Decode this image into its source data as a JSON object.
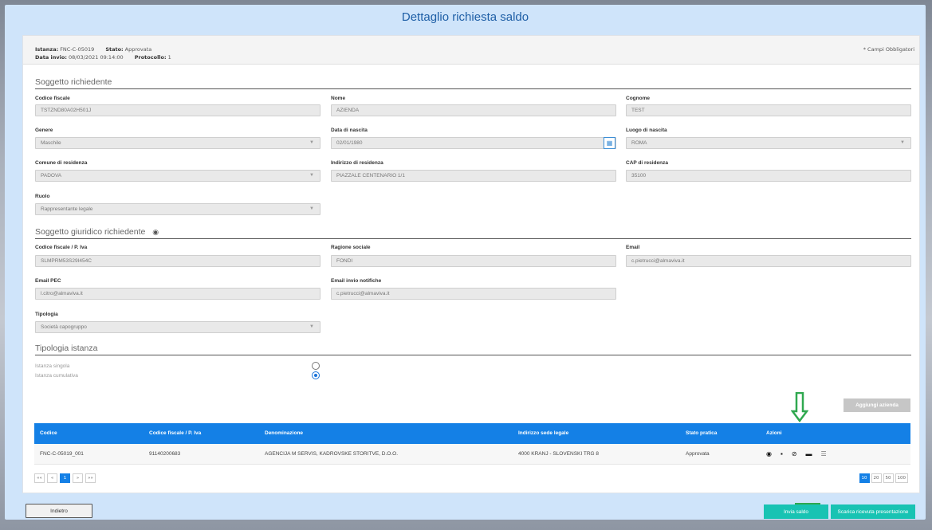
{
  "page": {
    "title": "Dettaglio richiesta saldo"
  },
  "info": {
    "istanza_label": "Istanza:",
    "istanza_value": "FNC-C-05019",
    "stato_label": "Stato:",
    "stato_value": "Approvata",
    "data_label": "Data invio:",
    "data_value": "08/03/2021 09:14:00",
    "protocollo_label": "Protocollo:",
    "protocollo_value": "1",
    "required_note": "* Campi Obbligatori"
  },
  "soggetto": {
    "title": "Soggetto richiedente",
    "fields": {
      "codice_fiscale": {
        "label": "Codice fiscale",
        "value": "TSTZND80A02H501J"
      },
      "nome": {
        "label": "Nome",
        "value": "AZIENDA"
      },
      "cognome": {
        "label": "Cognome",
        "value": "TEST"
      },
      "genere": {
        "label": "Genere",
        "value": "Maschile"
      },
      "data_nascita": {
        "label": "Data di nascita",
        "value": "02/01/1980"
      },
      "luogo_nascita": {
        "label": "Luogo di nascita",
        "value": "ROMA"
      },
      "comune_residenza": {
        "label": "Comune di residenza",
        "value": "PADOVA"
      },
      "indirizzo_residenza": {
        "label": "Indirizzo di residenza",
        "value": "PIAZZALE CENTENARIO 1/1"
      },
      "cap_residenza": {
        "label": "CAP di residenza",
        "value": "35100"
      },
      "ruolo": {
        "label": "Ruolo",
        "value": "Rappresentante legale"
      }
    }
  },
  "giuridico": {
    "title": "Soggetto giuridico richiedente",
    "fields": {
      "cf_piva": {
        "label": "Codice fiscale / P. Iva",
        "value": "SLMPRM53S29I454C"
      },
      "ragione_sociale": {
        "label": "Ragione sociale",
        "value": "FONDI"
      },
      "email": {
        "label": "Email",
        "value": "c.pietrucci@almaviva.it"
      },
      "email_pec": {
        "label": "Email PEC",
        "value": "l.citro@almaviva.it"
      },
      "email_notifiche": {
        "label": "Email invio notifiche",
        "value": "c.pietrucci@almaviva.it"
      },
      "tipologia": {
        "label": "Tipologia",
        "value": "Società capogruppo"
      }
    }
  },
  "tipologia_istanza": {
    "title": "Tipologia istanza",
    "options": [
      {
        "label": "Istanza singola",
        "checked": false
      },
      {
        "label": "Istanza cumulativa",
        "checked": true
      }
    ]
  },
  "buttons": {
    "add_company": "Aggiungi azienda",
    "back": "Indietro",
    "send": "Invia saldo",
    "download": "Scarica ricevuta presentazione"
  },
  "table": {
    "headers": [
      "Codice",
      "Codice fiscale / P. Iva",
      "Denominazione",
      "Indirizzo sede legale",
      "Stato pratica",
      "Azioni"
    ],
    "rows": [
      {
        "codice": "FNC-C-05019_001",
        "cf": "91140200683",
        "denominazione": "AGENCIJA M SERVIS, KADROVSKE STORITVE, D.O.O.",
        "indirizzo": "4000 KRANJ - SLOVENSKI TRG 8",
        "stato": "Approvata"
      }
    ]
  },
  "pagination": {
    "first": "««",
    "prev": "«",
    "current": "1",
    "next": "»",
    "last": "»»",
    "page_sizes": [
      "10",
      "20",
      "50",
      "100"
    ],
    "selected_size": "10"
  },
  "colors": {
    "accent": "#1480e6",
    "teal": "#18c3b3",
    "annotation": "#2fa84f"
  }
}
